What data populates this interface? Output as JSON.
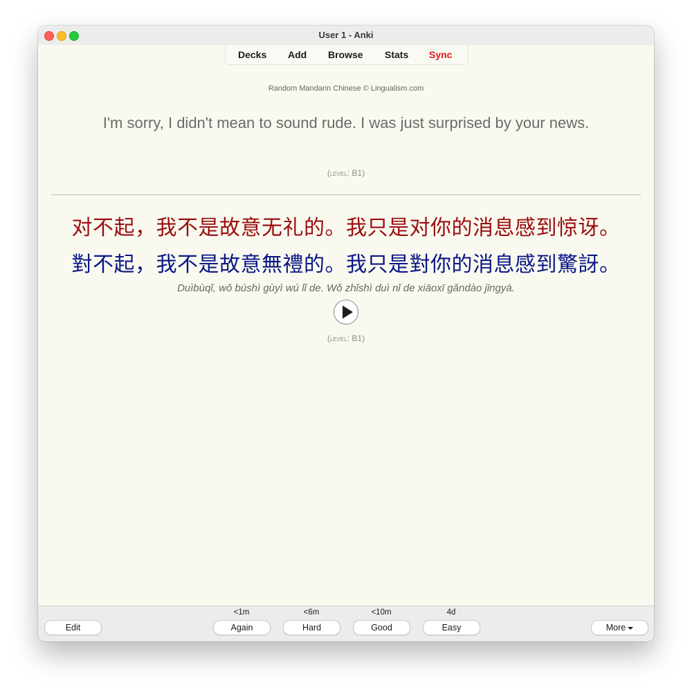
{
  "window": {
    "title": "User 1 - Anki"
  },
  "toolbar": {
    "decks": "Decks",
    "add": "Add",
    "browse": "Browse",
    "stats": "Stats",
    "sync": "Sync",
    "sync_color": "#e0161b"
  },
  "card": {
    "source": "Random Mandarin Chinese © Lingualism.com",
    "question": "I'm sorry, I didn't mean to sound rude. I was just surprised by your news.",
    "level_label": "level",
    "level_value": ": B1",
    "simplified": "对不起，我不是故意无礼的。我只是对你的消息感到惊讶。",
    "simplified_color": "#9a0d0d",
    "traditional": "對不起，我不是故意無禮的。我只是對你的消息感到驚訝。",
    "traditional_color": "#0a1784",
    "pinyin": "Duìbùqǐ, wǒ búshì gùyì wú lǐ de. Wǒ zhǐshì duì nǐ de xiāoxī gǎndào jīngyà.",
    "play_icon": "play-icon"
  },
  "bottom": {
    "edit": "Edit",
    "more": "More",
    "answers": [
      {
        "interval": "<1m",
        "label": "Again"
      },
      {
        "interval": "<6m",
        "label": "Hard"
      },
      {
        "interval": "<10m",
        "label": "Good"
      },
      {
        "interval": "4d",
        "label": "Easy"
      }
    ]
  }
}
